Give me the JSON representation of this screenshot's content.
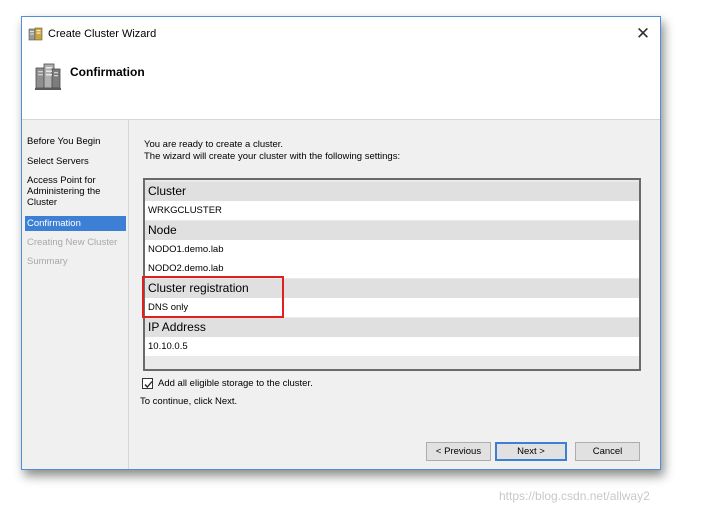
{
  "window": {
    "title": "Create Cluster Wizard",
    "close_glyph": "✕",
    "icon": "cluster-wizard-icon"
  },
  "header": {
    "title": "Confirmation",
    "icon": "server-cluster-icon"
  },
  "nav": {
    "items": [
      {
        "label": "Before You Begin",
        "state": "normal"
      },
      {
        "label": "Select Servers",
        "state": "normal"
      },
      {
        "label": "Access Point for Administering the Cluster",
        "state": "normal"
      },
      {
        "label": "Confirmation",
        "state": "active"
      },
      {
        "label": "Creating New Cluster",
        "state": "disabled"
      },
      {
        "label": "Summary",
        "state": "disabled"
      }
    ]
  },
  "content": {
    "intro_line1": "You are ready to create a cluster.",
    "intro_line2": "The wizard will create your cluster with the following settings:",
    "sections": [
      {
        "heading": "Cluster",
        "values": [
          "WRKGCLUSTER"
        ]
      },
      {
        "heading": "Node",
        "values": [
          "NODO1.demo.lab",
          "NODO2.demo.lab"
        ]
      },
      {
        "heading": "Cluster registration",
        "values": [
          "DNS only"
        ]
      },
      {
        "heading": "IP Address",
        "values": [
          "10.10.0.5"
        ]
      }
    ],
    "add_storage": {
      "label": "Add all eligible storage to the cluster.",
      "checked": true
    },
    "continue_text": "To continue, click Next."
  },
  "buttons": {
    "previous": "< Previous",
    "next": "Next >",
    "cancel": "Cancel"
  },
  "watermark": "https://blog.csdn.net/allway2",
  "colors": {
    "accent": "#3d7fd5",
    "highlight": "#e02020"
  }
}
